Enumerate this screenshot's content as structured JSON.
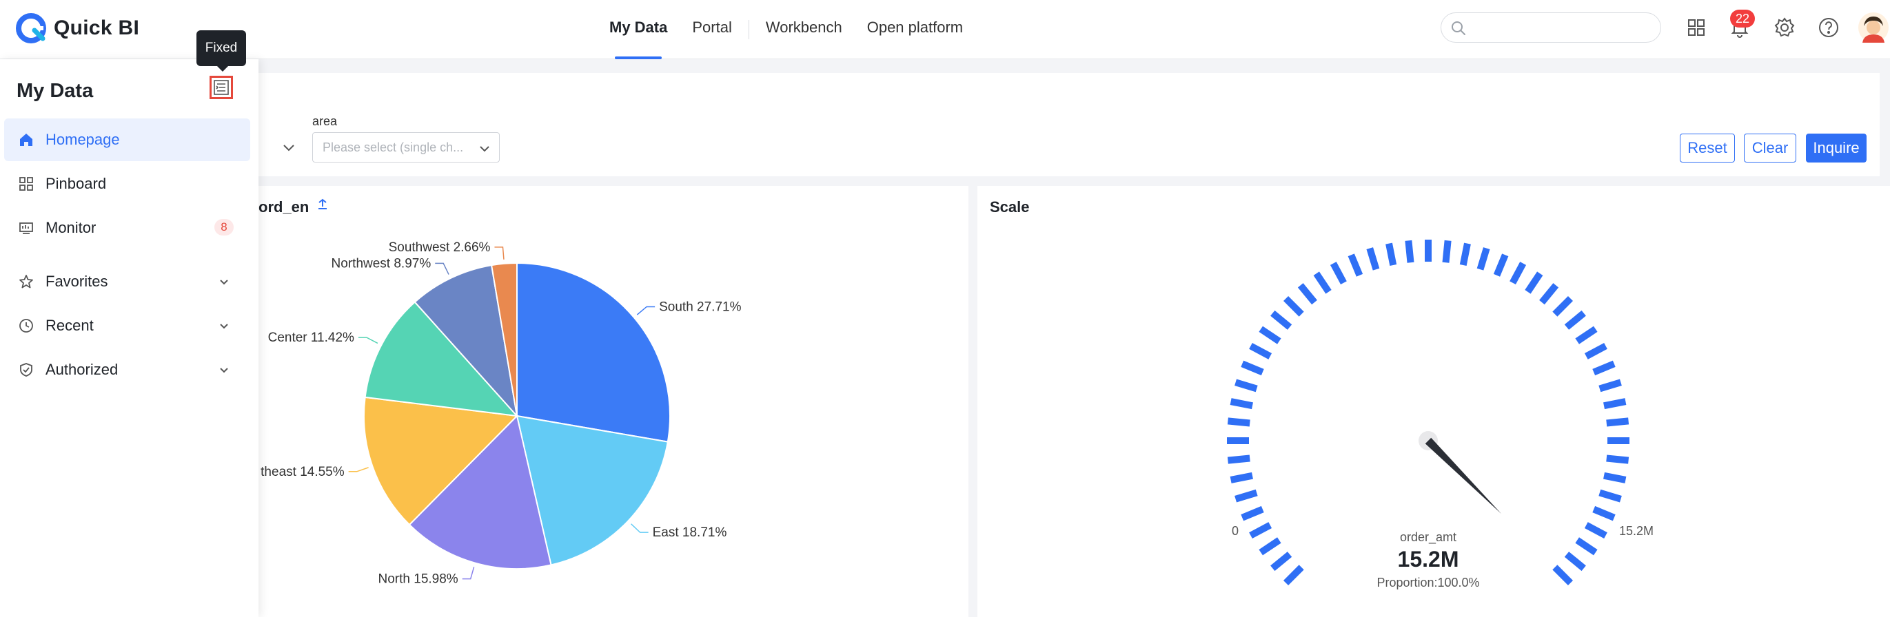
{
  "app": {
    "name": "Quick BI"
  },
  "nav": {
    "items": [
      "My Data",
      "Portal",
      "Workbench",
      "Open platform"
    ],
    "active": "My Data"
  },
  "search": {
    "placeholder": ""
  },
  "notifications": {
    "count": "22"
  },
  "sidebar": {
    "title": "My Data",
    "fixed_tooltip": "Fixed",
    "items": [
      {
        "label": "Homepage",
        "icon": "home-icon"
      },
      {
        "label": "Pinboard",
        "icon": "pinboard-icon"
      },
      {
        "label": "Monitor",
        "icon": "monitor-icon",
        "count": "8"
      },
      {
        "label": "Favorites",
        "icon": "star-icon"
      },
      {
        "label": "Recent",
        "icon": "clock-icon"
      },
      {
        "label": "Authorized",
        "icon": "shield-icon"
      }
    ]
  },
  "filters": {
    "area_label": "area",
    "area_placeholder": "Please select (single ch...",
    "reset": "Reset",
    "clear": "Clear",
    "inquire": "Inquire"
  },
  "colors": {
    "accent": "#2f6ff5",
    "badge": "#f23d3d"
  },
  "pie_card": {
    "title_fragment": "ord_en"
  },
  "gauge_card": {
    "title": "Scale",
    "min_label": "0",
    "max_label": "15.2M",
    "measure": "order_amt",
    "value_text": "15.2M",
    "proportion": "Proportion:100.0%"
  },
  "chart_data": [
    {
      "type": "pie",
      "categories": [
        "South",
        "East",
        "North",
        "Southeast",
        "Center",
        "Northwest",
        "Southwest"
      ],
      "values": [
        27.71,
        18.71,
        15.98,
        14.55,
        11.42,
        8.97,
        2.66
      ],
      "labels": [
        "South 27.71%",
        "East 18.71%",
        "North 15.98%",
        "theast 14.55%",
        "Center 11.42%",
        "Northwest 8.97%",
        "Southwest 2.66%"
      ],
      "colors": [
        "#3b7bf6",
        "#63cbf5",
        "#8b84ec",
        "#fbc04a",
        "#55d4b4",
        "#6a85c5",
        "#e9894f"
      ]
    },
    {
      "type": "gauge",
      "value": 15.2,
      "min": 0,
      "max": 15.2,
      "unit": "M",
      "proportion": 1.0
    }
  ]
}
